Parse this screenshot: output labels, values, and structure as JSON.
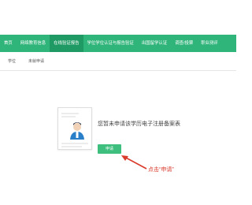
{
  "nav": {
    "items": [
      {
        "label": "首页"
      },
      {
        "label": "网络教育信息"
      },
      {
        "label": "在线验证报告"
      },
      {
        "label": "学位学位认证与报告验证"
      },
      {
        "label": "出国留学认证"
      },
      {
        "label": "调查/投票"
      },
      {
        "label": "职业测评"
      }
    ],
    "active_index": 2,
    "bar_color": "#2fb47a",
    "active_color": "#1f9a64"
  },
  "subnav": {
    "items": [
      {
        "label": "学位"
      },
      {
        "label": "未就申请"
      }
    ]
  },
  "main": {
    "message": "您暂未申请该学历电子注册备案表",
    "apply_button_label": "申请",
    "doc_icon": "document-avatar-icon",
    "button_color": "#3fbf7e"
  },
  "annotation": {
    "text": "点击“申请”",
    "color": "#d93a2b",
    "arrow_icon": "arrow-up-left-icon"
  }
}
